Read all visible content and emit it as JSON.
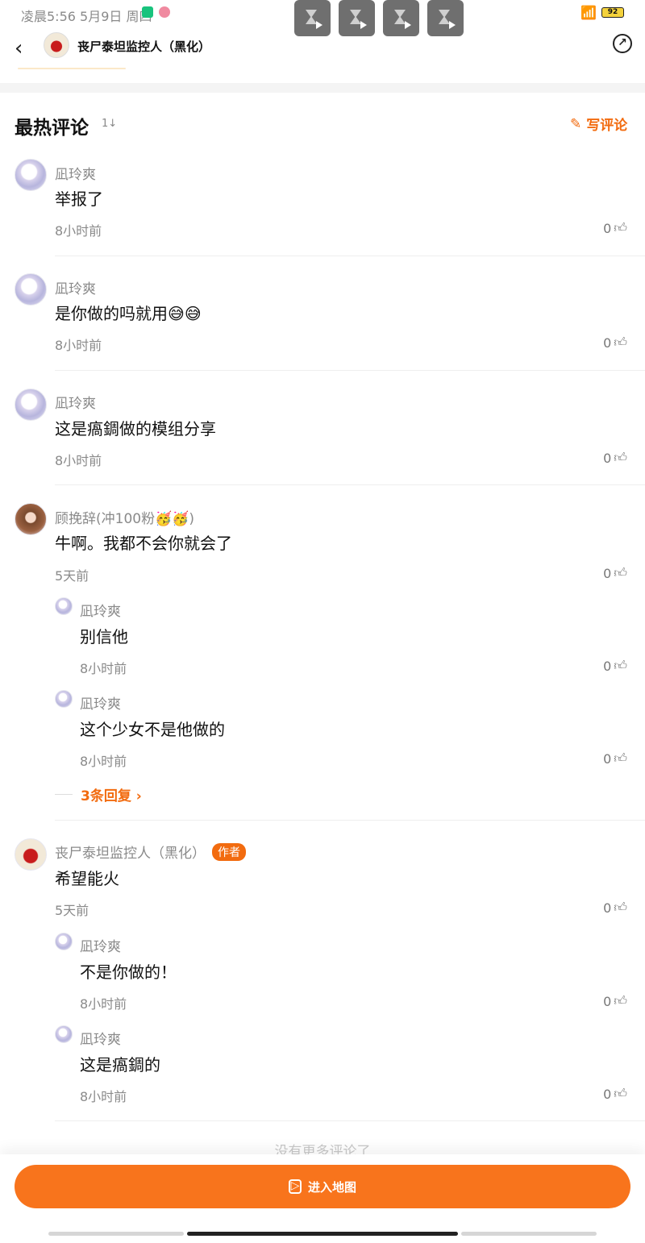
{
  "status_bar": {
    "time": "凌晨5:56  5月9日 周四",
    "battery": "92"
  },
  "nav": {
    "title": "丧尸泰坦监控人（黑化）"
  },
  "section": {
    "title": "最热评论",
    "sort_label": "1↓",
    "write_label": "写评论"
  },
  "comments": [
    {
      "user": "凪玲爽",
      "text": "举报了",
      "time": "8小时前",
      "likes": "0"
    },
    {
      "user": "凪玲爽",
      "text": "是你做的吗就用😅😅",
      "time": "8小时前",
      "likes": "0"
    },
    {
      "user": "凪玲爽",
      "text": "这是瘑錭做的模组分享",
      "time": "8小时前",
      "likes": "0"
    },
    {
      "user": "顾挽辞(冲100粉🥳🥳)",
      "text": "牛啊。我都不会你就会了",
      "time": "5天前",
      "likes": "0",
      "replies": [
        {
          "user": "凪玲爽",
          "text": "别信他",
          "time": "8小时前",
          "likes": "0"
        },
        {
          "user": "凪玲爽",
          "text": "这个少女不是他做的",
          "time": "8小时前",
          "likes": "0"
        }
      ],
      "more_replies": "3条回复 ›"
    },
    {
      "user": "丧尸泰坦监控人（黑化）",
      "badge": "作者",
      "text": "希望能火",
      "time": "5天前",
      "likes": "0",
      "replies": [
        {
          "user": "凪玲爽",
          "text": "不是你做的！",
          "time": "8小时前",
          "likes": "0"
        },
        {
          "user": "凪玲爽",
          "text": "这是瘑錭的",
          "time": "8小时前",
          "likes": "0"
        }
      ]
    }
  ],
  "footer": {
    "no_more": "没有更多评论了",
    "enter_button": "进入地图"
  }
}
